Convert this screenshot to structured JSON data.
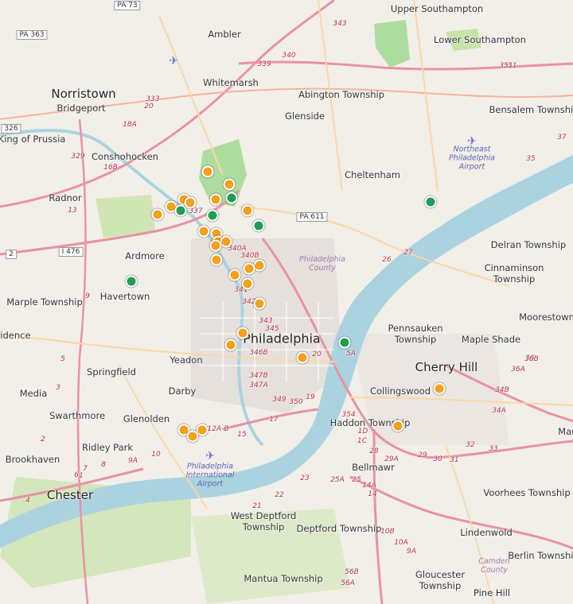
{
  "map": {
    "colors": {
      "land": "#f2efe9",
      "water": "#aad3df",
      "park": "#c8e2a8",
      "forest": "#addd9e",
      "motorway": "#e892a2",
      "trunk": "#f9b29c",
      "primary": "#fcd6a4",
      "minor": "#ffffff",
      "urban": "#e6e0dc",
      "marker_orange": "#f4a11c",
      "marker_green": "#1e9e55"
    },
    "places": [
      {
        "id": "norristown",
        "text": "Norristown",
        "cls": "place-major"
      },
      {
        "id": "bridgeport",
        "text": "Bridgeport",
        "cls": "place"
      },
      {
        "id": "king-of-prussia",
        "text": "King of Prussia",
        "cls": "place"
      },
      {
        "id": "conshohocken",
        "text": "Conshohocken",
        "cls": "place"
      },
      {
        "id": "radnor",
        "text": "Radnor",
        "cls": "place"
      },
      {
        "id": "ardmore",
        "text": "Ardmore",
        "cls": "place"
      },
      {
        "id": "havertown",
        "text": "Havertown",
        "cls": "place"
      },
      {
        "id": "marple-township",
        "text": "Marple Township",
        "cls": "place"
      },
      {
        "id": "vidence",
        "text": "vidence",
        "cls": "place"
      },
      {
        "id": "springfield",
        "text": "Springfield",
        "cls": "place"
      },
      {
        "id": "yeadon",
        "text": "Yeadon",
        "cls": "place"
      },
      {
        "id": "media",
        "text": "Media",
        "cls": "place"
      },
      {
        "id": "darby",
        "text": "Darby",
        "cls": "place"
      },
      {
        "id": "swarthmore",
        "text": "Swarthmore",
        "cls": "place"
      },
      {
        "id": "glenolden",
        "text": "Glenolden",
        "cls": "place"
      },
      {
        "id": "ridley-park",
        "text": "Ridley Park",
        "cls": "place"
      },
      {
        "id": "brookhaven",
        "text": "Brookhaven",
        "cls": "place"
      },
      {
        "id": "chester",
        "text": "Chester",
        "cls": "place-major"
      },
      {
        "id": "ambler",
        "text": "Ambler",
        "cls": "place"
      },
      {
        "id": "whitemarsh",
        "text": "Whitemarsh",
        "cls": "place"
      },
      {
        "id": "abington-township",
        "text": "Abington Township",
        "cls": "place"
      },
      {
        "id": "glenside",
        "text": "Glenside",
        "cls": "place"
      },
      {
        "id": "cheltenham",
        "text": "Cheltenham",
        "cls": "place"
      },
      {
        "id": "upper-southampton",
        "text": "Upper Southampton",
        "cls": "place"
      },
      {
        "id": "lower-southampton",
        "text": "Lower Southampton",
        "cls": "place"
      },
      {
        "id": "bensalem-township",
        "text": "Bensalem Township",
        "cls": "place"
      },
      {
        "id": "delran-township",
        "text": "Delran Township",
        "cls": "place"
      },
      {
        "id": "cinnaminson-township",
        "text": "Cinnaminson\nTownship",
        "cls": "place"
      },
      {
        "id": "moorestown",
        "text": "Moorestown",
        "cls": "place"
      },
      {
        "id": "pennsauken-township",
        "text": "Pennsauken\nTownship",
        "cls": "place"
      },
      {
        "id": "maple-shade",
        "text": "Maple Shade",
        "cls": "place"
      },
      {
        "id": "cherry-hill",
        "text": "Cherry Hill",
        "cls": "place-major"
      },
      {
        "id": "collingswood",
        "text": "Collingswood",
        "cls": "place"
      },
      {
        "id": "haddon-township",
        "text": "Haddon Township",
        "cls": "place"
      },
      {
        "id": "bellmawr",
        "text": "Bellmawr",
        "cls": "place"
      },
      {
        "id": "philadelphia",
        "text": "Philadelphia",
        "cls": "place-city"
      },
      {
        "id": "west-deptford-township",
        "text": "West Deptford\nTownship",
        "cls": "place"
      },
      {
        "id": "deptford-township",
        "text": "Deptford Township",
        "cls": "place"
      },
      {
        "id": "voorhees-township",
        "text": "Voorhees Township",
        "cls": "place"
      },
      {
        "id": "lindenwold",
        "text": "Lindenwold",
        "cls": "place"
      },
      {
        "id": "berlin-township",
        "text": "Berlin Township",
        "cls": "place"
      },
      {
        "id": "mantua-township",
        "text": "Mantua Township",
        "cls": "place"
      },
      {
        "id": "gloucester-township",
        "text": "Gloucester\nTownship",
        "cls": "place"
      },
      {
        "id": "pine-hill",
        "text": "Pine Hill",
        "cls": "place"
      },
      {
        "id": "mar",
        "text": "Mar",
        "cls": "place"
      }
    ],
    "special_labels": [
      {
        "id": "philadelphia-county",
        "text": "Philadelphia\nCounty",
        "cls": "county"
      },
      {
        "id": "camden-county",
        "text": "Camden\nCounty",
        "cls": "county"
      },
      {
        "id": "northeast-philadelphia-airport",
        "text": "Northeast\nPhiladelphia\nAirport",
        "cls": "airport"
      },
      {
        "id": "philadelphia-international-airport",
        "text": "Philadelphia\nInternational\nAirport",
        "cls": "airport"
      }
    ],
    "shields": [
      {
        "id": "pa-363",
        "text": "PA 363"
      },
      {
        "id": "pa-73",
        "text": "PA 73"
      },
      {
        "id": "pa-611",
        "text": "PA 611"
      },
      {
        "id": "i-476",
        "text": "I 476"
      },
      {
        "id": "edge-326",
        "text": "326"
      },
      {
        "id": "edge-2",
        "text": "2"
      }
    ],
    "route_labels": [
      "343",
      "339",
      "340",
      "333",
      "20",
      "18A",
      "329",
      "16B",
      "13",
      "9",
      "5",
      "3",
      "2",
      "1",
      "4",
      "337",
      "340A",
      "340B",
      "341",
      "342",
      "343",
      "345",
      "346B",
      "347B",
      "347A",
      "349",
      "350",
      "19",
      "17",
      "15",
      "12A-B",
      "12",
      "10",
      "9A",
      "8",
      "7",
      "6",
      "22",
      "21",
      "23",
      "25A",
      "25",
      "14A",
      "14",
      "1D",
      "1C",
      "28",
      "29A",
      "29",
      "30",
      "31",
      "32",
      "33",
      "34B",
      "34A",
      "35",
      "36",
      "36A",
      "36B",
      "37",
      "351",
      "10B",
      "10A",
      "9A",
      "56B",
      "56A",
      "27",
      "26",
      "20",
      "5A",
      "354",
      "351"
    ],
    "markers": [
      {
        "color": "orange"
      },
      {
        "color": "orange"
      },
      {
        "color": "orange"
      },
      {
        "color": "orange"
      },
      {
        "color": "orange"
      },
      {
        "color": "orange"
      },
      {
        "color": "green"
      },
      {
        "color": "green"
      },
      {
        "color": "orange"
      },
      {
        "color": "green"
      },
      {
        "color": "orange"
      },
      {
        "color": "green"
      },
      {
        "color": "orange"
      },
      {
        "color": "orange"
      },
      {
        "color": "orange"
      },
      {
        "color": "orange"
      },
      {
        "color": "orange"
      },
      {
        "color": "orange"
      },
      {
        "color": "orange"
      },
      {
        "color": "orange"
      },
      {
        "color": "orange"
      },
      {
        "color": "orange"
      },
      {
        "color": "orange"
      },
      {
        "color": "orange"
      },
      {
        "color": "orange"
      },
      {
        "color": "orange"
      },
      {
        "color": "green"
      },
      {
        "color": "green"
      },
      {
        "color": "green"
      },
      {
        "color": "orange"
      },
      {
        "color": "orange"
      },
      {
        "color": "orange"
      },
      {
        "color": "orange"
      },
      {
        "color": "orange"
      }
    ]
  }
}
